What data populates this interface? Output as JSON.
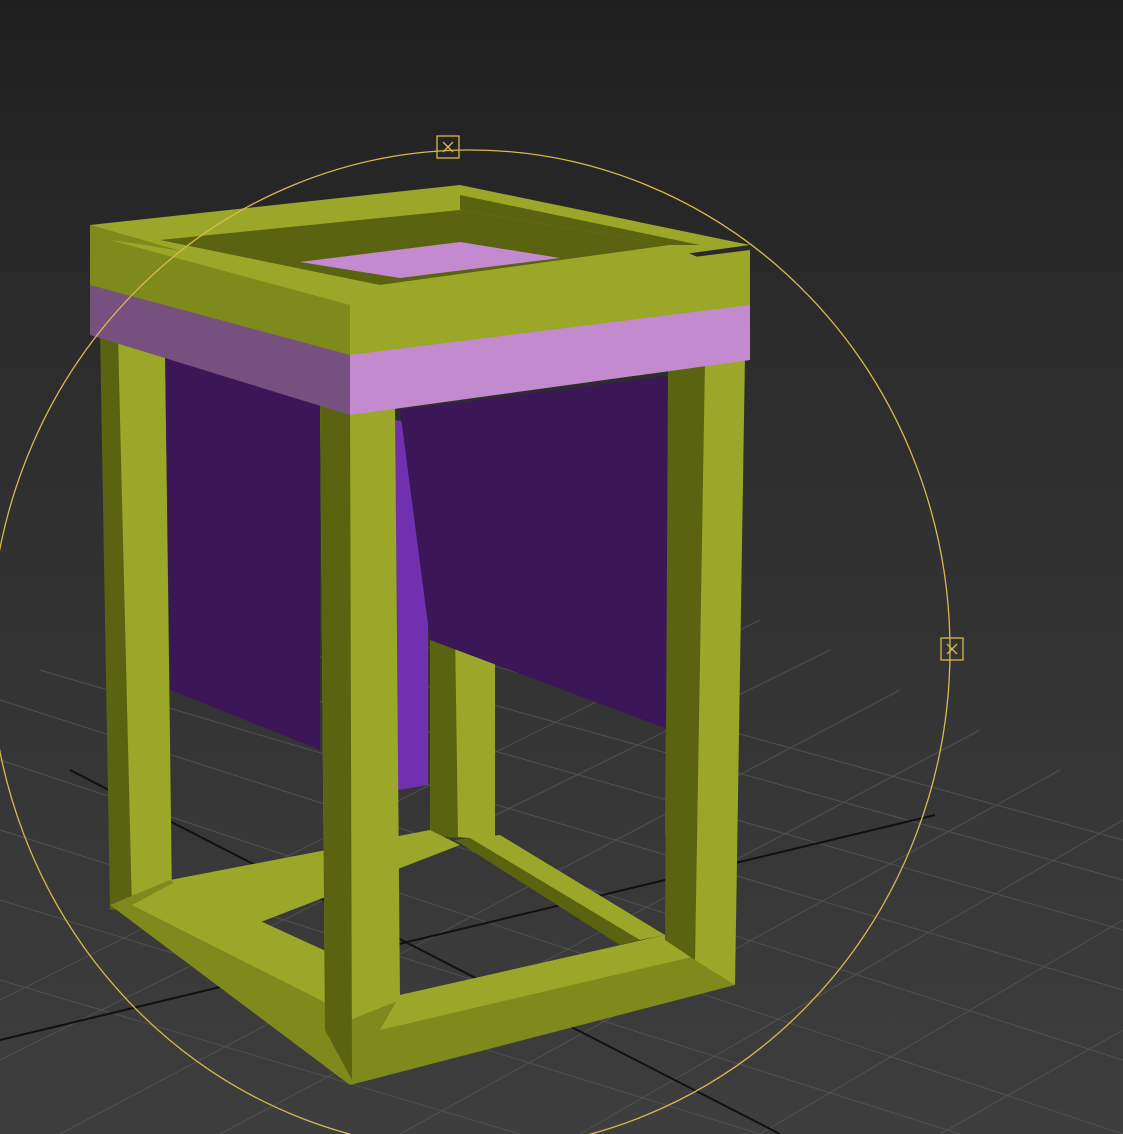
{
  "viewport": {
    "name": "3d-perspective-viewport",
    "background_top": "#1f1f1f",
    "background_bottom": "#3e3e3e",
    "grid_color": "#555555",
    "axis_color": "#111111"
  },
  "scene": {
    "object": "nightstand-frame",
    "colors": {
      "frame_light": "#9ba728",
      "frame_dark": "#5a6310",
      "frame_mid": "#7f8a1c",
      "panel_pink": "#c38ad0",
      "panel_pink_dark": "#76507e",
      "panel_purple": "#3c1758",
      "panel_purple_edge": "#7130b0"
    }
  },
  "gizmo": {
    "type": "rotate-gizmo",
    "color": "#d8b94e",
    "handles": [
      "rotate-handle-top",
      "rotate-handle-right"
    ]
  }
}
